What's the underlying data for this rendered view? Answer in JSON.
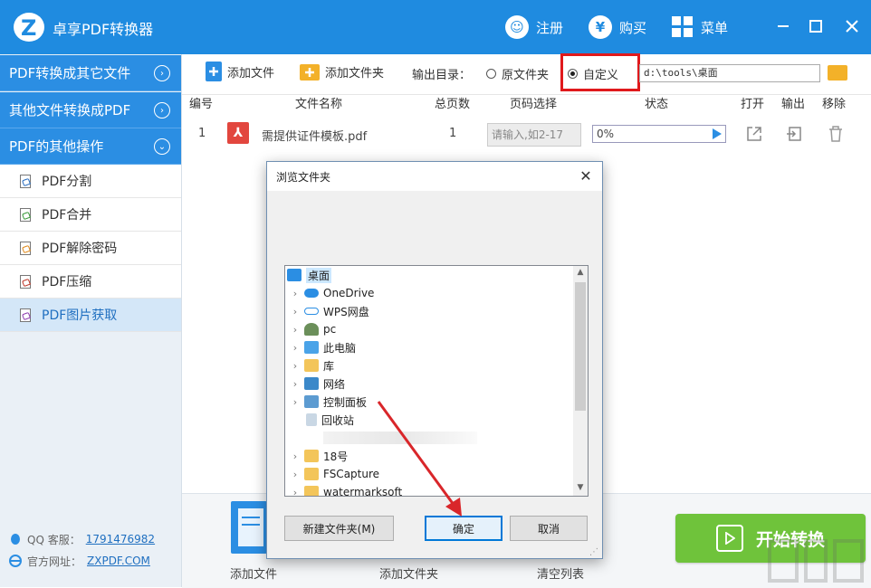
{
  "app": {
    "title": "卓享PDF转换器",
    "register_label": "注册",
    "buy_label": "购买",
    "menu_label": "菜单"
  },
  "sidebar": {
    "groups": [
      {
        "label": "PDF转换成其它文件"
      },
      {
        "label": "其他文件转换成PDF"
      },
      {
        "label": "PDF的其他操作"
      }
    ],
    "items": [
      {
        "label": "PDF分割"
      },
      {
        "label": "PDF合并"
      },
      {
        "label": "PDF解除密码"
      },
      {
        "label": "PDF压缩"
      },
      {
        "label": "PDF图片获取",
        "active": true
      }
    ],
    "footer": {
      "qq_label": "QQ 客服：",
      "qq_value": "1791476982",
      "site_label": "官方网址：",
      "site_value": "ZXPDF.COM"
    }
  },
  "toolbar": {
    "add_file": "添加文件",
    "add_folder": "添加文件夹",
    "output_dir_label": "输出目录：",
    "option_original": "原文件夹",
    "option_custom": "自定义",
    "output_path": "d:\\tools\\桌面"
  },
  "table": {
    "headers": [
      "编号",
      "文件名称",
      "总页数",
      "页码选择",
      "状态",
      "打开",
      "输出",
      "移除"
    ],
    "rows": [
      {
        "index": "1",
        "filename": "需提供证件模板.pdf",
        "pages": "1",
        "page_placeholder": "请输入,如2-17",
        "progress": "0%"
      }
    ]
  },
  "bottom": {
    "add_file": "添加文件",
    "add_folder": "添加文件夹",
    "clear_list": "清空列表",
    "start": "开始转换"
  },
  "dialog": {
    "title": "浏览文件夹",
    "tree": [
      {
        "label": "桌面",
        "icon": "desktop-icon",
        "selected": true
      },
      {
        "label": "OneDrive",
        "icon": "cloud-icon"
      },
      {
        "label": "WPS网盘",
        "icon": "cloud-outline-icon"
      },
      {
        "label": "pc",
        "icon": "user-icon"
      },
      {
        "label": "此电脑",
        "icon": "computer-icon"
      },
      {
        "label": "库",
        "icon": "library-icon"
      },
      {
        "label": "网络",
        "icon": "network-icon"
      },
      {
        "label": "控制面板",
        "icon": "control-panel-icon"
      },
      {
        "label": "回收站",
        "icon": "recycle-bin-icon"
      },
      {
        "label": "",
        "icon": ""
      },
      {
        "label": "18号",
        "icon": "folder-icon"
      },
      {
        "label": "FSCapture",
        "icon": "folder-icon"
      },
      {
        "label": "watermarksoft",
        "icon": "folder-icon"
      }
    ],
    "new_folder": "新建文件夹(M)",
    "ok": "确定",
    "cancel": "取消"
  },
  "colors": {
    "titlebar": "#1f8be0",
    "sidebar_group": "#2b8ee3",
    "start_button": "#6fc33b",
    "highlight_box": "#e0191c",
    "annotation_arrow": "#d9262a"
  }
}
